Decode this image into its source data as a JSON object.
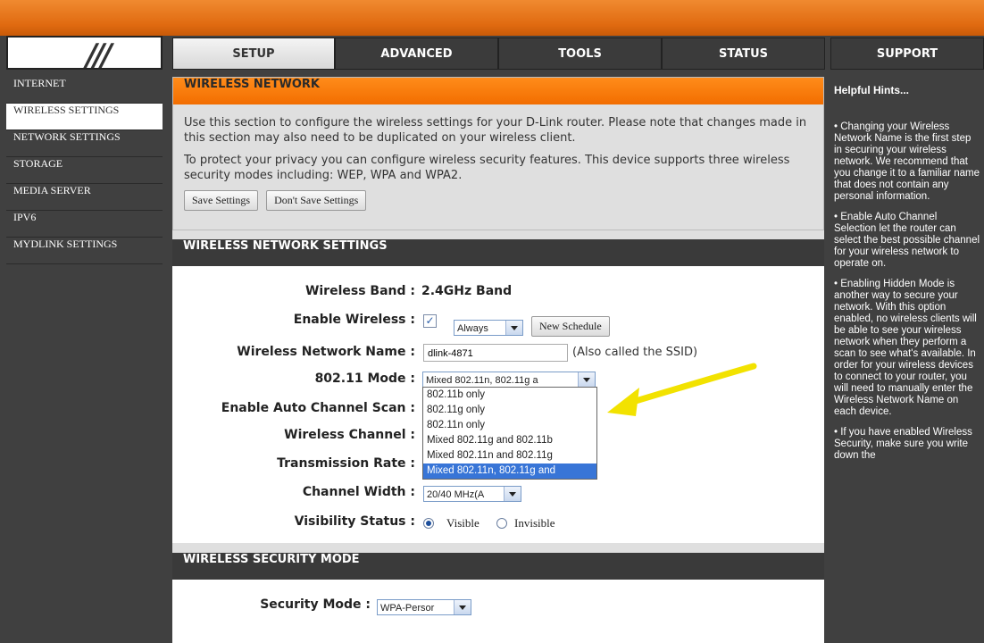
{
  "tabs": [
    "SETUP",
    "ADVANCED",
    "TOOLS",
    "STATUS",
    "SUPPORT"
  ],
  "sidebar": [
    "INTERNET",
    "WIRELESS SETTINGS",
    "NETWORK SETTINGS",
    "STORAGE",
    "MEDIA SERVER",
    "IPV6",
    "MYDLINK SETTINGS"
  ],
  "wireless_network": {
    "title": "WIRELESS NETWORK",
    "p1": "Use this section to configure the wireless settings for your D-Link router. Please note that changes made in this section may also need to be duplicated on your wireless client.",
    "p2": "To protect your privacy you can configure wireless security features. This device supports three wireless security modes including: WEP, WPA and WPA2.",
    "save": "Save Settings",
    "dont_save": "Don't Save Settings"
  },
  "settings": {
    "title": "WIRELESS NETWORK SETTINGS",
    "band_label": "Wireless Band :",
    "band_value": "2.4GHz Band",
    "enable_label": "Enable Wireless :",
    "enable_sched": "Always",
    "new_schedule": "New Schedule",
    "ssid_label": "Wireless Network Name :",
    "ssid_value": "dlink-4871",
    "ssid_note": "(Also called the SSID)",
    "mode_label": "802.11 Mode :",
    "mode_value": "Mixed 802.11n, 802.11g a",
    "mode_options": [
      "802.11b only",
      "802.11g only",
      "802.11n only",
      "Mixed 802.11g and 802.11b",
      "Mixed 802.11n and 802.11g",
      "Mixed 802.11n, 802.11g and"
    ],
    "auto_label": "Enable Auto Channel Scan :",
    "channel_label": "Wireless Channel :",
    "rate_label": "Transmission Rate :",
    "width_label": "Channel Width :",
    "width_value": "20/40 MHz(A",
    "vis_label": "Visibility Status :",
    "visible": "Visible",
    "invisible": "Invisible"
  },
  "security": {
    "title": "WIRELESS SECURITY MODE",
    "mode_label": "Security Mode :",
    "mode_value": "WPA-Persor"
  },
  "help": {
    "title": "Helpful Hints...",
    "tips": [
      "• Changing your Wireless Network Name is the first step in securing your wireless network. We recommend that you change it to a familiar name that does not contain any personal information.",
      "• Enable Auto Channel Selection let the router can select the best possible channel for your wireless network to operate on.",
      "• Enabling Hidden Mode is another way to secure your network. With this option enabled, no wireless clients will be able to see your wireless network when they perform a scan to see what's available. In order for your wireless devices to connect to your router, you will need to manually enter the Wireless Network Name on each device.",
      "• If you have enabled Wireless Security, make sure you write down the"
    ]
  }
}
